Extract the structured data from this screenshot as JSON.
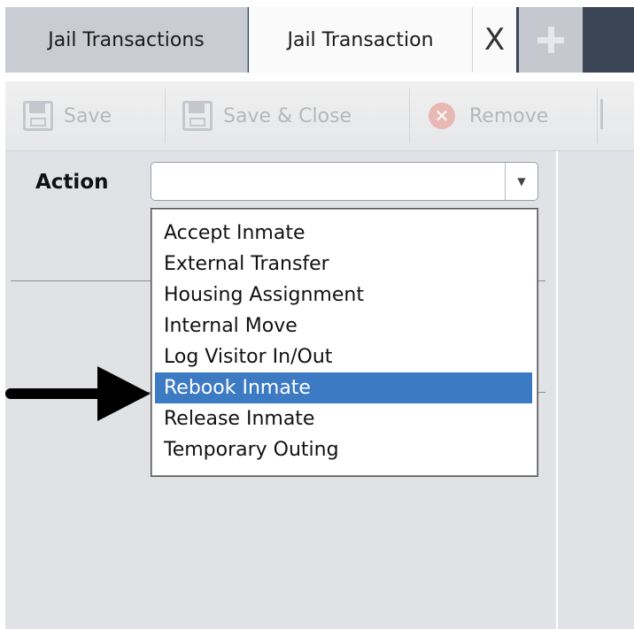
{
  "tabs": {
    "jail_transactions_label": "Jail Transactions",
    "jail_transaction_label": "Jail Transaction",
    "close_symbol": "X",
    "add_icon": "plus-icon"
  },
  "toolbar": {
    "save_label": "Save",
    "save_close_label": "Save & Close",
    "remove_label": "Remove",
    "save_icon": "disk-icon",
    "remove_icon": "remove-x-icon"
  },
  "form": {
    "action_label": "Action",
    "action_value": ""
  },
  "dropdown": {
    "items": [
      "Accept Inmate",
      "External Transfer",
      "Housing Assignment",
      "Internal Move",
      "Log Visitor In/Out",
      "Rebook Inmate",
      "Release Inmate",
      "Temporary Outing"
    ],
    "selected": "Rebook Inmate"
  },
  "colors": {
    "selection": "#3d7ac4",
    "tab_strip": "#3c4556",
    "panel_bg": "#e0e2e5"
  }
}
